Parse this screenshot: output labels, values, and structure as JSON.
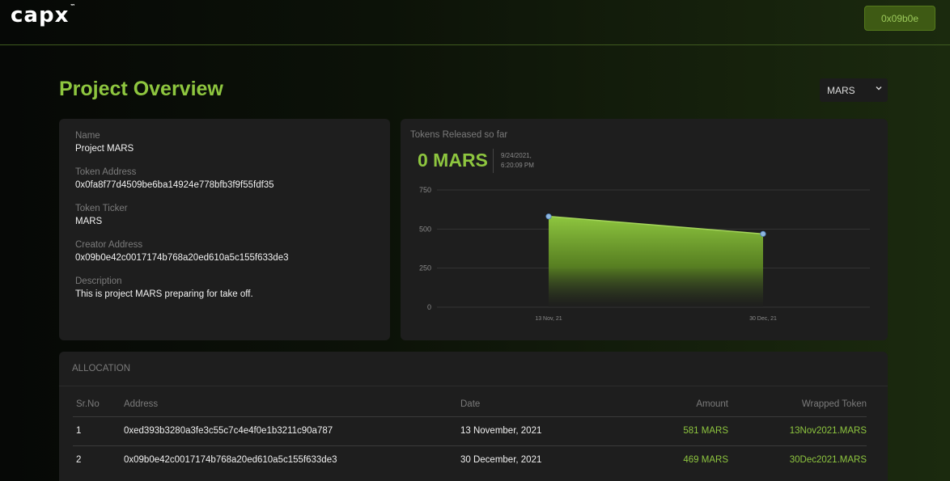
{
  "header": {
    "logo_text": "capx",
    "logo_tm": "™",
    "wallet_label": "0x09b0e"
  },
  "page": {
    "title": "Project Overview",
    "project_select_value": "MARS"
  },
  "info": {
    "name_label": "Name",
    "name_value": "Project MARS",
    "token_address_label": "Token Address",
    "token_address_value": "0x0fa8f77d4509be6ba14924e778bfb3f9f55fdf35",
    "token_ticker_label": "Token Ticker",
    "token_ticker_value": "MARS",
    "creator_address_label": "Creator Address",
    "creator_address_value": "0x09b0e42c0017174b768a20ed610a5c155f633de3",
    "description_label": "Description",
    "description_value": "This is project MARS preparing for take off."
  },
  "chart_panel": {
    "title": "Tokens Released so far",
    "value": "0 MARS",
    "timestamp_date": "9/24/2021,",
    "timestamp_time": "6:20:09 PM"
  },
  "chart_data": {
    "type": "area",
    "x": [
      "13 Nov, 21",
      "30 Dec, 21"
    ],
    "series": [
      {
        "values": [
          581,
          469
        ]
      }
    ],
    "y_ticks": [
      "750",
      "500",
      "250",
      "0"
    ],
    "ylim": [
      0,
      750
    ],
    "grid": true,
    "color": "#8ec63f"
  },
  "allocation": {
    "title": "ALLOCATION",
    "columns": [
      "Sr.No",
      "Address",
      "Date",
      "Amount",
      "Wrapped Token"
    ],
    "rows": [
      [
        "1",
        "0xed393b3280a3fe3c55c7c4e4f0e1b3211c90a787",
        "13 November, 2021",
        "581 MARS",
        "13Nov2021.MARS"
      ],
      [
        "2",
        "0x09b0e42c0017174b768a20ed610a5c155f633de3",
        "30 December, 2021",
        "469 MARS",
        "30Dec2021.MARS"
      ]
    ]
  },
  "colors": {
    "accent": "#8ec63f",
    "button_bg": "#3e5a14",
    "card_bg": "#1e1e1e"
  }
}
